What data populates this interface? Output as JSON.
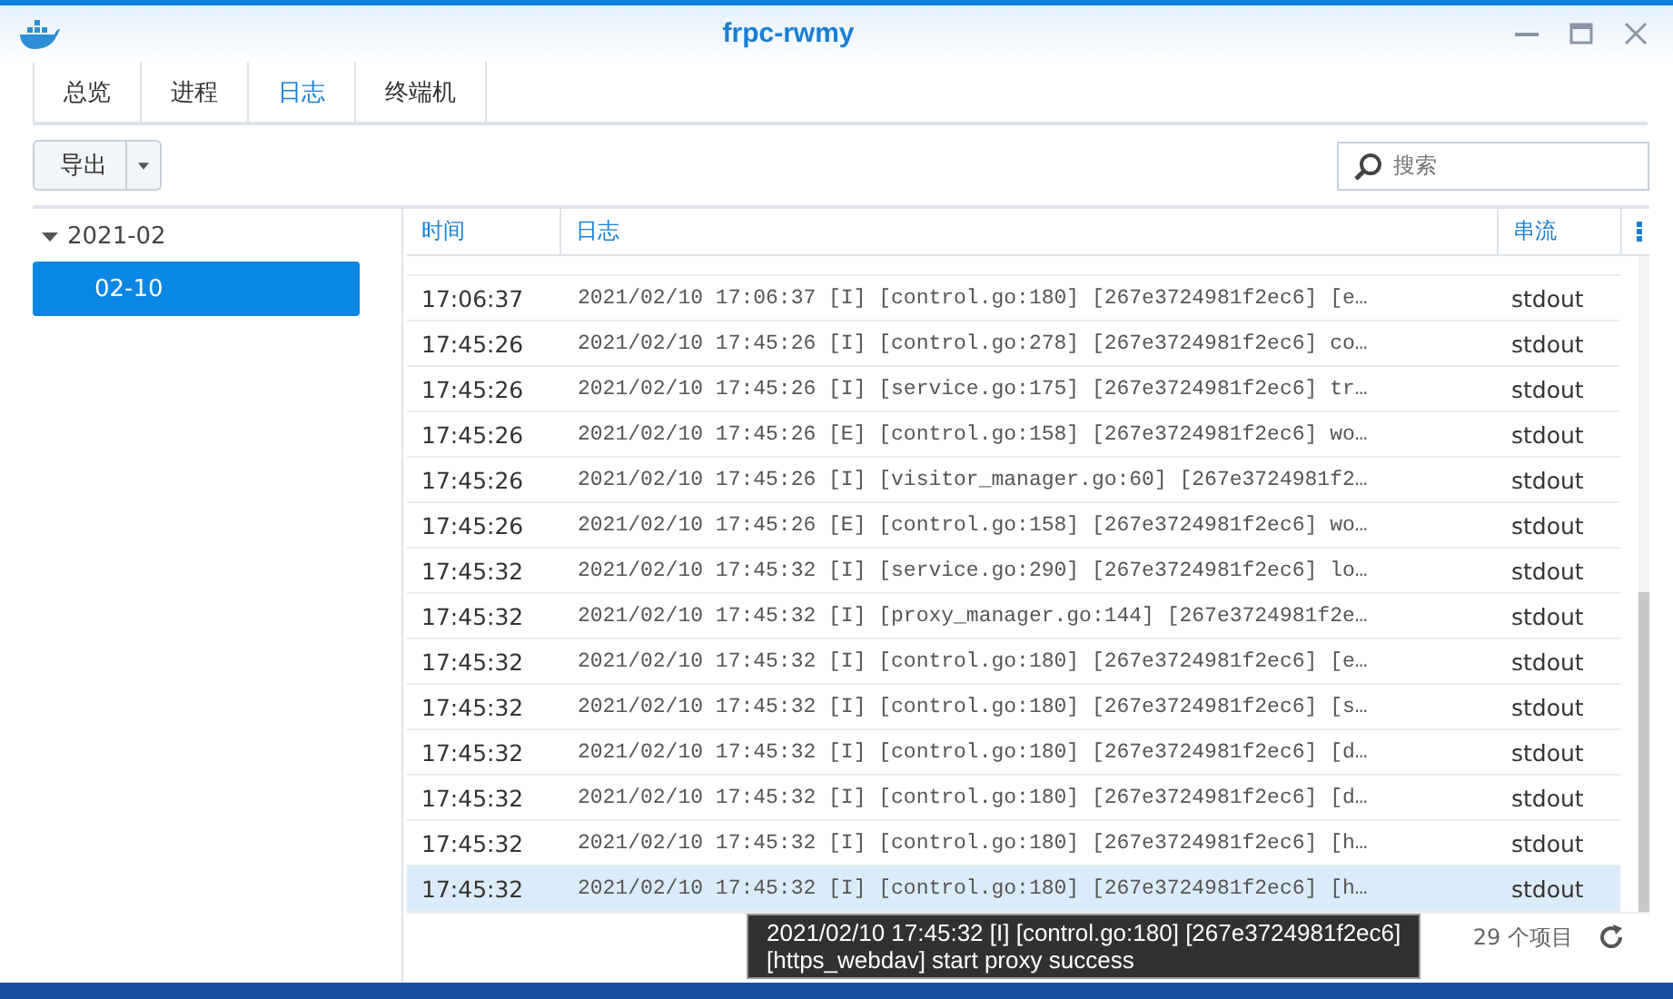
{
  "window": {
    "title": "frpc-rwmy"
  },
  "tabs": [
    {
      "label": "总览",
      "selected": false
    },
    {
      "label": "进程",
      "selected": false
    },
    {
      "label": "日志",
      "selected": true
    },
    {
      "label": "终端机",
      "selected": false
    }
  ],
  "toolbar": {
    "export_button": "导出",
    "search": {
      "placeholder": "搜索"
    }
  },
  "sidebar": {
    "items": [
      {
        "label": "2021-02",
        "expanded": true,
        "selected": false,
        "children": [
          {
            "label": "02-10",
            "selected": true
          }
        ]
      }
    ]
  },
  "table": {
    "columns": [
      "时间",
      "日志",
      "串流"
    ],
    "rows": [
      {
        "time": "17:06:37",
        "log": "2021/02/10 17:06:37 [I] [control.go:180] [267e3724981f2ec6] [e…",
        "stream": "stdout",
        "selected": false
      },
      {
        "time": "17:45:26",
        "log": "2021/02/10 17:45:26 [I] [control.go:278] [267e3724981f2ec6] co…",
        "stream": "stdout",
        "selected": false
      },
      {
        "time": "17:45:26",
        "log": "2021/02/10 17:45:26 [I] [service.go:175] [267e3724981f2ec6] tr…",
        "stream": "stdout",
        "selected": false
      },
      {
        "time": "17:45:26",
        "log": "2021/02/10 17:45:26 [E] [control.go:158] [267e3724981f2ec6] wo…",
        "stream": "stdout",
        "selected": false
      },
      {
        "time": "17:45:26",
        "log": "2021/02/10 17:45:26 [I] [visitor_manager.go:60] [267e3724981f2…",
        "stream": "stdout",
        "selected": false
      },
      {
        "time": "17:45:26",
        "log": "2021/02/10 17:45:26 [E] [control.go:158] [267e3724981f2ec6] wo…",
        "stream": "stdout",
        "selected": false
      },
      {
        "time": "17:45:32",
        "log": "2021/02/10 17:45:32 [I] [service.go:290] [267e3724981f2ec6] lo…",
        "stream": "stdout",
        "selected": false
      },
      {
        "time": "17:45:32",
        "log": "2021/02/10 17:45:32 [I] [proxy_manager.go:144] [267e3724981f2e…",
        "stream": "stdout",
        "selected": false
      },
      {
        "time": "17:45:32",
        "log": "2021/02/10 17:45:32 [I] [control.go:180] [267e3724981f2ec6] [e…",
        "stream": "stdout",
        "selected": false
      },
      {
        "time": "17:45:32",
        "log": "2021/02/10 17:45:32 [I] [control.go:180] [267e3724981f2ec6] [s…",
        "stream": "stdout",
        "selected": false
      },
      {
        "time": "17:45:32",
        "log": "2021/02/10 17:45:32 [I] [control.go:180] [267e3724981f2ec6] [d…",
        "stream": "stdout",
        "selected": false
      },
      {
        "time": "17:45:32",
        "log": "2021/02/10 17:45:32 [I] [control.go:180] [267e3724981f2ec6] [d…",
        "stream": "stdout",
        "selected": false
      },
      {
        "time": "17:45:32",
        "log": "2021/02/10 17:45:32 [I] [control.go:180] [267e3724981f2ec6] [h…",
        "stream": "stdout",
        "selected": false
      },
      {
        "time": "17:45:32",
        "log": "2021/02/10 17:45:32 [I] [control.go:180] [267e3724981f2ec6] [h…",
        "stream": "stdout",
        "selected": true
      }
    ],
    "footer": {
      "count": "29 个项目"
    }
  },
  "tooltip": {
    "lines": [
      "2021/02/10 17:45:32 [I] [control.go:180] [267e3724981f2ec6]",
      "[https_webdav] start proxy success"
    ]
  }
}
